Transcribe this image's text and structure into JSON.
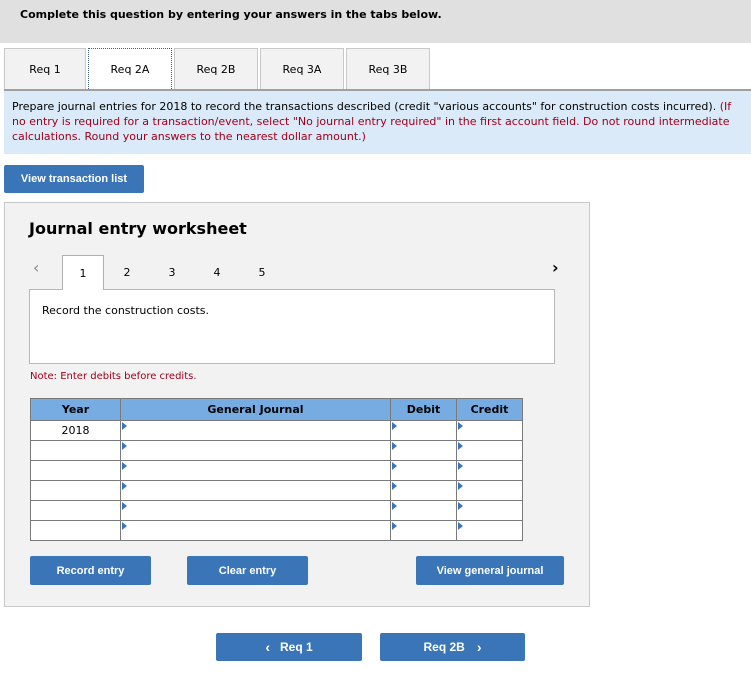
{
  "banner": {
    "title": "Complete this question by entering your answers in the tabs below."
  },
  "tabs": [
    {
      "label": "Req 1",
      "active": false
    },
    {
      "label": "Req 2A",
      "active": true
    },
    {
      "label": "Req 2B",
      "active": false
    },
    {
      "label": "Req 3A",
      "active": false
    },
    {
      "label": "Req 3B",
      "active": false
    }
  ],
  "instructions": {
    "main": "Prepare journal entries for 2018 to record the transactions described (credit \"various accounts\" for construction costs incurred).",
    "note": "(If no entry is required for a transaction/event, select \"No journal entry required\" in the first account field. Do not round intermediate calculations. Round your answers to the nearest dollar amount.)"
  },
  "view_transaction_list_label": "View transaction list",
  "worksheet": {
    "title": "Journal entry worksheet",
    "pages": [
      "1",
      "2",
      "3",
      "4",
      "5"
    ],
    "active_page": "1",
    "prev_icon": "‹",
    "next_icon": "›",
    "description": "Record the construction costs.",
    "note": "Note: Enter debits before credits.",
    "columns": [
      "Year",
      "General Journal",
      "Debit",
      "Credit"
    ],
    "rows": [
      {
        "year": "2018",
        "account": "",
        "debit": "",
        "credit": ""
      },
      {
        "year": "",
        "account": "",
        "debit": "",
        "credit": ""
      },
      {
        "year": "",
        "account": "",
        "debit": "",
        "credit": ""
      },
      {
        "year": "",
        "account": "",
        "debit": "",
        "credit": ""
      },
      {
        "year": "",
        "account": "",
        "debit": "",
        "credit": ""
      },
      {
        "year": "",
        "account": "",
        "debit": "",
        "credit": ""
      }
    ],
    "buttons": {
      "record": "Record entry",
      "clear": "Clear entry",
      "view_general_journal": "View general journal"
    }
  },
  "nav": {
    "prev_label": "Req 1",
    "next_label": "Req 2B",
    "prev_icon": "‹",
    "next_icon": "›"
  },
  "colors": {
    "button_blue": "#3a75b8",
    "header_blue": "#76ace2",
    "instructions_bg": "#daeaf8",
    "note_red": "#a0001c"
  }
}
